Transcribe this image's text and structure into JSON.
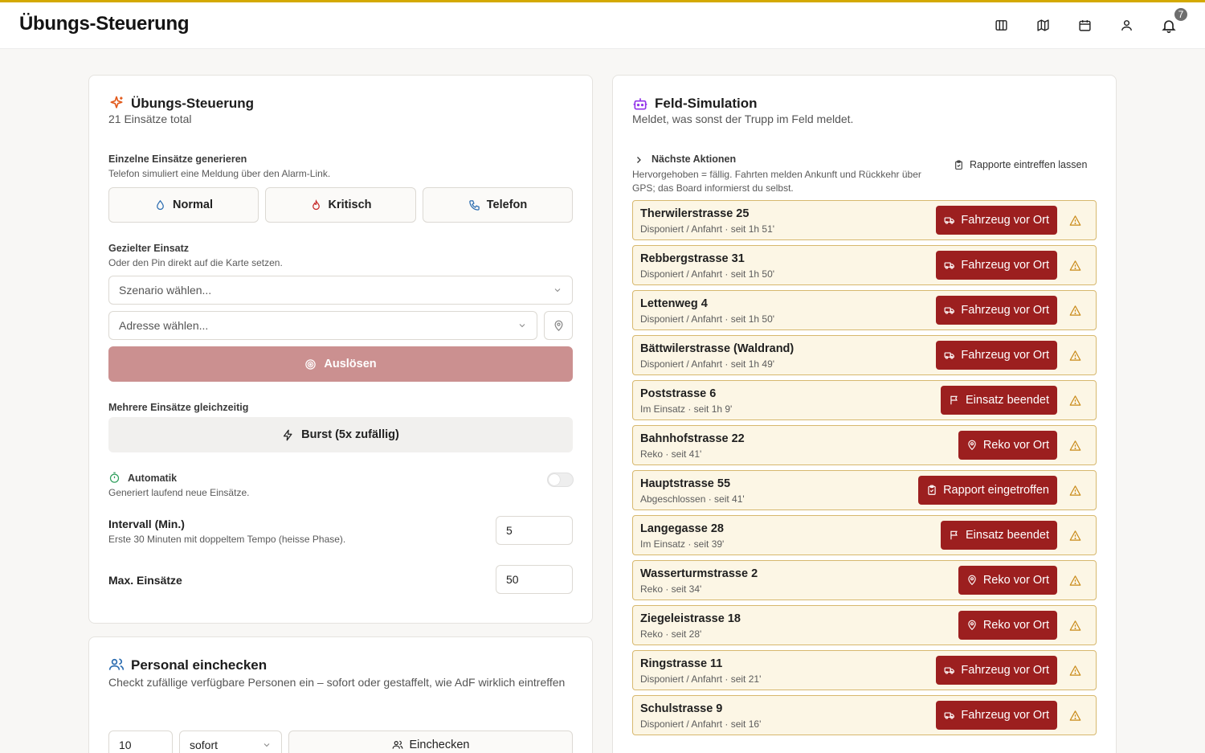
{
  "app": {
    "title": "Übungs-Steuerung",
    "notification_count": "7"
  },
  "header_icons": [
    "columns-icon",
    "map-icon",
    "calendar-icon",
    "user-icon",
    "bell-icon"
  ],
  "uebung": {
    "title": "Übungs-Steuerung",
    "subtitle": "21 Einsätze total",
    "single": {
      "title": "Einzelne Einsätze generieren",
      "subtitle": "Telefon simuliert eine Meldung über den Alarm-Link.",
      "buttons": {
        "normal": "Normal",
        "kritisch": "Kritisch",
        "telefon": "Telefon"
      }
    },
    "targeted": {
      "title": "Gezielter Einsatz",
      "subtitle": "Oder den Pin direkt auf die Karte setzen.",
      "scenario_placeholder": "Szenario wählen...",
      "address_placeholder": "Adresse wählen...",
      "fire_label": "Auslösen"
    },
    "multi": {
      "title": "Mehrere Einsätze gleichzeitig",
      "burst_label": "Burst (5x zufällig)"
    },
    "auto": {
      "title": "Automatik",
      "subtitle": "Generiert laufend neue Einsätze.",
      "enabled": false,
      "interval_label": "Intervall (Min.)",
      "interval_hint": "Erste 30 Minuten mit doppeltem Tempo (heisse Phase).",
      "interval_value": "5",
      "max_label": "Max. Einsätze",
      "max_value": "50"
    }
  },
  "personal": {
    "title": "Personal einchecken",
    "subtitle": "Checkt zufällige verfügbare Personen ein – sofort oder gestaffelt, wie AdF wirklich eintreffen",
    "count_value": "10",
    "mode_value": "sofort",
    "checkin_label": "Einchecken"
  },
  "feld": {
    "title": "Feld-Simulation",
    "subtitle": "Meldet, was sonst der Trupp im Feld meldet.",
    "next_title": "Nächste Aktionen",
    "next_hint": "Hervorgehoben = fällig. Fahrten melden Ankunft und Rückkehr über GPS; das Board informierst du selbst.",
    "rapporte_label": "Rapporte eintreffen lassen",
    "missions": [
      {
        "address": "Therwilerstrasse 25",
        "status": "Disponiert / Anfahrt · seit 1h 51'",
        "action": "Fahrzeug vor Ort",
        "icon": "truck-icon"
      },
      {
        "address": "Rebbergstrasse 31",
        "status": "Disponiert / Anfahrt · seit 1h 50'",
        "action": "Fahrzeug vor Ort",
        "icon": "truck-icon"
      },
      {
        "address": "Lettenweg 4",
        "status": "Disponiert / Anfahrt · seit 1h 50'",
        "action": "Fahrzeug vor Ort",
        "icon": "truck-icon"
      },
      {
        "address": "Bättwilerstrasse (Waldrand)",
        "status": "Disponiert / Anfahrt · seit 1h 49'",
        "action": "Fahrzeug vor Ort",
        "icon": "truck-icon"
      },
      {
        "address": "Poststrasse 6",
        "status": "Im Einsatz · seit 1h 9'",
        "action": "Einsatz beendet",
        "icon": "flag-icon"
      },
      {
        "address": "Bahnhofstrasse 22",
        "status": "Reko · seit 41'",
        "action": "Reko vor Ort",
        "icon": "pin-icon"
      },
      {
        "address": "Hauptstrasse 55",
        "status": "Abgeschlossen · seit 41'",
        "action": "Rapport eingetroffen",
        "icon": "clipboard-icon"
      },
      {
        "address": "Langegasse 28",
        "status": "Im Einsatz · seit 39'",
        "action": "Einsatz beendet",
        "icon": "flag-icon"
      },
      {
        "address": "Wasserturmstrasse 2",
        "status": "Reko · seit 34'",
        "action": "Reko vor Ort",
        "icon": "pin-icon"
      },
      {
        "address": "Ziegeleistrasse 18",
        "status": "Reko · seit 28'",
        "action": "Reko vor Ort",
        "icon": "pin-icon"
      },
      {
        "address": "Ringstrasse 11",
        "status": "Disponiert / Anfahrt · seit 21'",
        "action": "Fahrzeug vor Ort",
        "icon": "truck-icon"
      },
      {
        "address": "Schulstrasse 9",
        "status": "Disponiert / Anfahrt · seit 16'",
        "action": "Fahrzeug vor Ort",
        "icon": "truck-icon"
      }
    ]
  },
  "colors": {
    "accent_gold": "#d4a900",
    "action_red": "#9c1f1f",
    "fire_disabled": "#cb9090",
    "mission_bg": "#fcf6e5",
    "mission_border": "#d7b86e",
    "warn": "#c98a18"
  }
}
